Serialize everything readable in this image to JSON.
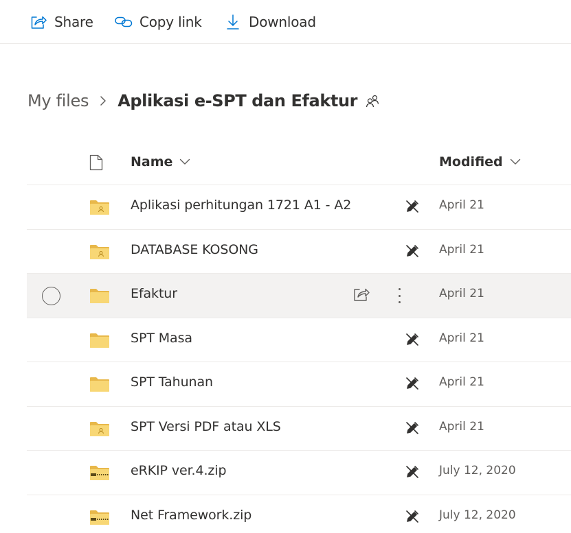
{
  "toolbar": {
    "share_label": "Share",
    "copy_link_label": "Copy link",
    "download_label": "Download"
  },
  "breadcrumb": {
    "root": "My files",
    "current": "Aplikasi e-SPT dan Efaktur"
  },
  "columns": {
    "name": "Name",
    "modified": "Modified"
  },
  "colors": {
    "accent": "#0078d4",
    "folder": "#f8d775",
    "folder_dark": "#e8b84a",
    "selected_row": "#f3f2f1"
  },
  "files": [
    {
      "name": "Aplikasi perhitungan 1721 A1 - A2",
      "modified": "April 21",
      "type": "shared-folder",
      "icon": "shared-folder-icon"
    },
    {
      "name": "DATABASE KOSONG",
      "modified": "April 21",
      "type": "shared-folder",
      "icon": "shared-folder-icon"
    },
    {
      "name": "Efaktur",
      "modified": "April 21",
      "type": "folder",
      "icon": "folder-icon",
      "selected": true
    },
    {
      "name": "SPT Masa",
      "modified": "April 21",
      "type": "folder",
      "icon": "folder-icon"
    },
    {
      "name": "SPT Tahunan",
      "modified": "April 21",
      "type": "folder",
      "icon": "folder-icon"
    },
    {
      "name": "SPT Versi PDF atau XLS",
      "modified": "April 21",
      "type": "shared-folder",
      "icon": "shared-folder-icon"
    },
    {
      "name": "eRKIP ver.4.zip",
      "modified": "July 12, 2020",
      "type": "zip",
      "icon": "zip-folder-icon"
    },
    {
      "name": "Net Framework.zip",
      "modified": "July 12, 2020",
      "type": "zip",
      "icon": "zip-folder-icon"
    }
  ]
}
